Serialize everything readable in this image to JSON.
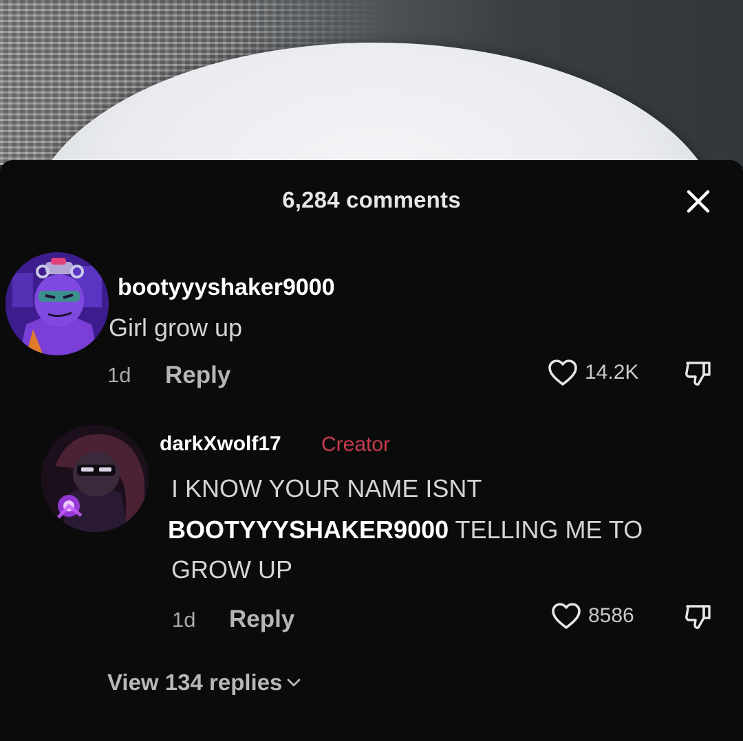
{
  "sheet": {
    "title": "6,284 comments",
    "close_icon": "close-icon"
  },
  "comments": [
    {
      "username": "bootyyyshaker9000",
      "text": "Girl grow up",
      "time": "1d",
      "reply_label": "Reply",
      "like_count": "14.2K",
      "avatar_icon": "avatar"
    },
    {
      "username": "darkXwolf17",
      "badge": "Creator",
      "text_line1": "I KNOW YOUR NAME ISNT",
      "mention": "BOOTYYYSHAKER9000",
      "text_line2_rest": "TELLING ME TO",
      "text_line3": "GROW UP",
      "time": "1d",
      "reply_label": "Reply",
      "like_count": "8586",
      "avatar_icon": "avatar"
    }
  ],
  "view_replies_label": "View 134 replies",
  "colors": {
    "sheet_background": "#0b0b0c",
    "creator_badge": "#c83b4d",
    "primary_text": "#ffffff",
    "secondary_text": "#a9a9a9"
  }
}
